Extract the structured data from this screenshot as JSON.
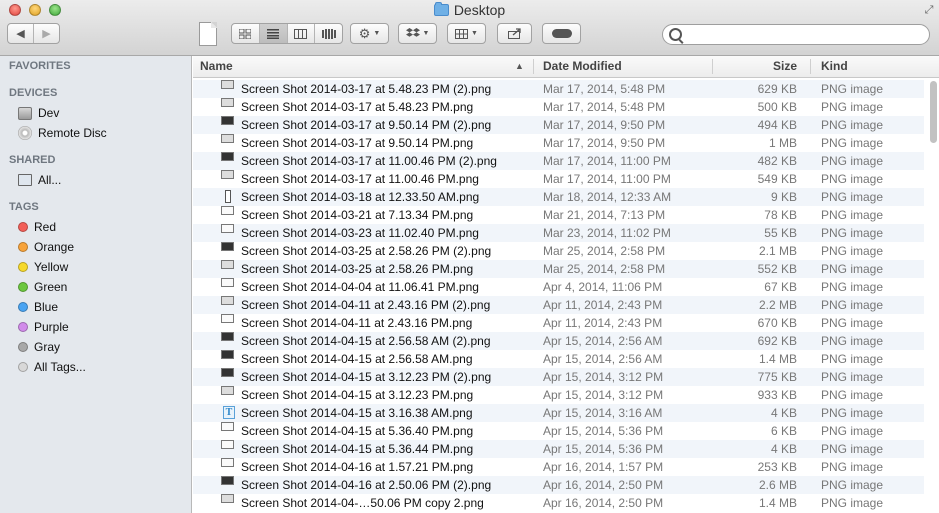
{
  "window": {
    "title": "Desktop"
  },
  "search": {
    "placeholder": ""
  },
  "sidebar": {
    "sections": [
      {
        "header": "FAVORITES",
        "items": []
      },
      {
        "header": "DEVICES",
        "items": [
          {
            "label": "Dev",
            "icon": "hard-drive-icon"
          },
          {
            "label": "Remote Disc",
            "icon": "disc-icon"
          }
        ]
      },
      {
        "header": "SHARED",
        "items": [
          {
            "label": "All...",
            "icon": "network-icon"
          }
        ]
      },
      {
        "header": "TAGS",
        "items": [
          {
            "label": "Red",
            "color": "#f25f58"
          },
          {
            "label": "Orange",
            "color": "#f7a33b"
          },
          {
            "label": "Yellow",
            "color": "#f6d92b"
          },
          {
            "label": "Green",
            "color": "#6cc73f"
          },
          {
            "label": "Blue",
            "color": "#4aa4f2"
          },
          {
            "label": "Purple",
            "color": "#d18bea"
          },
          {
            "label": "Gray",
            "color": "#a8a8a8"
          },
          {
            "label": "All Tags...",
            "color": "#d8d8d8"
          }
        ]
      }
    ]
  },
  "columns": {
    "name": "Name",
    "date": "Date Modified",
    "size": "Size",
    "kind": "Kind"
  },
  "files": [
    {
      "name": "Screen Shot 2014-03-17 at 5.48.23 PM (2).png",
      "date": "Mar 17, 2014, 5:48 PM",
      "size": "629 KB",
      "kind": "PNG image",
      "thumb": "gray"
    },
    {
      "name": "Screen Shot 2014-03-17 at 5.48.23 PM.png",
      "date": "Mar 17, 2014, 5:48 PM",
      "size": "500 KB",
      "kind": "PNG image",
      "thumb": "gray"
    },
    {
      "name": "Screen Shot 2014-03-17 at 9.50.14 PM (2).png",
      "date": "Mar 17, 2014, 9:50 PM",
      "size": "494 KB",
      "kind": "PNG image",
      "thumb": "dark"
    },
    {
      "name": "Screen Shot 2014-03-17 at 9.50.14 PM.png",
      "date": "Mar 17, 2014, 9:50 PM",
      "size": "1 MB",
      "kind": "PNG image",
      "thumb": "gray"
    },
    {
      "name": "Screen Shot 2014-03-17 at 11.00.46 PM (2).png",
      "date": "Mar 17, 2014, 11:00 PM",
      "size": "482 KB",
      "kind": "PNG image",
      "thumb": "dark"
    },
    {
      "name": "Screen Shot 2014-03-17 at 11.00.46 PM.png",
      "date": "Mar 17, 2014, 11:00 PM",
      "size": "549 KB",
      "kind": "PNG image",
      "thumb": "gray"
    },
    {
      "name": "Screen Shot 2014-03-18 at 12.33.50 AM.png",
      "date": "Mar 18, 2014, 12:33 AM",
      "size": "9 KB",
      "kind": "PNG image",
      "thumb": "phone"
    },
    {
      "name": "Screen Shot 2014-03-21 at 7.13.34 PM.png",
      "date": "Mar 21, 2014, 7:13 PM",
      "size": "78 KB",
      "kind": "PNG image",
      "thumb": "light"
    },
    {
      "name": "Screen Shot 2014-03-23 at 11.02.40 PM.png",
      "date": "Mar 23, 2014, 11:02 PM",
      "size": "55 KB",
      "kind": "PNG image",
      "thumb": "light"
    },
    {
      "name": "Screen Shot 2014-03-25 at 2.58.26 PM (2).png",
      "date": "Mar 25, 2014, 2:58 PM",
      "size": "2.1 MB",
      "kind": "PNG image",
      "thumb": "dark"
    },
    {
      "name": "Screen Shot 2014-03-25 at 2.58.26 PM.png",
      "date": "Mar 25, 2014, 2:58 PM",
      "size": "552 KB",
      "kind": "PNG image",
      "thumb": "gray"
    },
    {
      "name": "Screen Shot 2014-04-04 at 11.06.41 PM.png",
      "date": "Apr 4, 2014, 11:06 PM",
      "size": "67 KB",
      "kind": "PNG image",
      "thumb": "light"
    },
    {
      "name": "Screen Shot 2014-04-11 at 2.43.16 PM (2).png",
      "date": "Apr 11, 2014, 2:43 PM",
      "size": "2.2 MB",
      "kind": "PNG image",
      "thumb": "gray"
    },
    {
      "name": "Screen Shot 2014-04-11 at 2.43.16 PM.png",
      "date": "Apr 11, 2014, 2:43 PM",
      "size": "670 KB",
      "kind": "PNG image",
      "thumb": "light"
    },
    {
      "name": "Screen Shot 2014-04-15 at 2.56.58 AM (2).png",
      "date": "Apr 15, 2014, 2:56 AM",
      "size": "692 KB",
      "kind": "PNG image",
      "thumb": "dark"
    },
    {
      "name": "Screen Shot 2014-04-15 at 2.56.58 AM.png",
      "date": "Apr 15, 2014, 2:56 AM",
      "size": "1.4 MB",
      "kind": "PNG image",
      "thumb": "dark"
    },
    {
      "name": "Screen Shot 2014-04-15 at 3.12.23 PM (2).png",
      "date": "Apr 15, 2014, 3:12 PM",
      "size": "775 KB",
      "kind": "PNG image",
      "thumb": "dark"
    },
    {
      "name": "Screen Shot 2014-04-15 at 3.12.23 PM.png",
      "date": "Apr 15, 2014, 3:12 PM",
      "size": "933 KB",
      "kind": "PNG image",
      "thumb": "gray"
    },
    {
      "name": "Screen Shot 2014-04-15 at 3.16.38 AM.png",
      "date": "Apr 15, 2014, 3:16 AM",
      "size": "4 KB",
      "kind": "PNG image",
      "thumb": "tw"
    },
    {
      "name": "Screen Shot 2014-04-15 at 5.36.40 PM.png",
      "date": "Apr 15, 2014, 5:36 PM",
      "size": "6 KB",
      "kind": "PNG image",
      "thumb": "light"
    },
    {
      "name": "Screen Shot 2014-04-15 at 5.36.44 PM.png",
      "date": "Apr 15, 2014, 5:36 PM",
      "size": "4 KB",
      "kind": "PNG image",
      "thumb": "light"
    },
    {
      "name": "Screen Shot 2014-04-16 at 1.57.21 PM.png",
      "date": "Apr 16, 2014, 1:57 PM",
      "size": "253 KB",
      "kind": "PNG image",
      "thumb": "light"
    },
    {
      "name": "Screen Shot 2014-04-16 at 2.50.06 PM (2).png",
      "date": "Apr 16, 2014, 2:50 PM",
      "size": "2.6 MB",
      "kind": "PNG image",
      "thumb": "dark"
    },
    {
      "name": "Screen Shot 2014-04-…50.06 PM copy 2.png",
      "date": "Apr 16, 2014, 2:50 PM",
      "size": "1.4 MB",
      "kind": "PNG image",
      "thumb": "gray"
    }
  ]
}
